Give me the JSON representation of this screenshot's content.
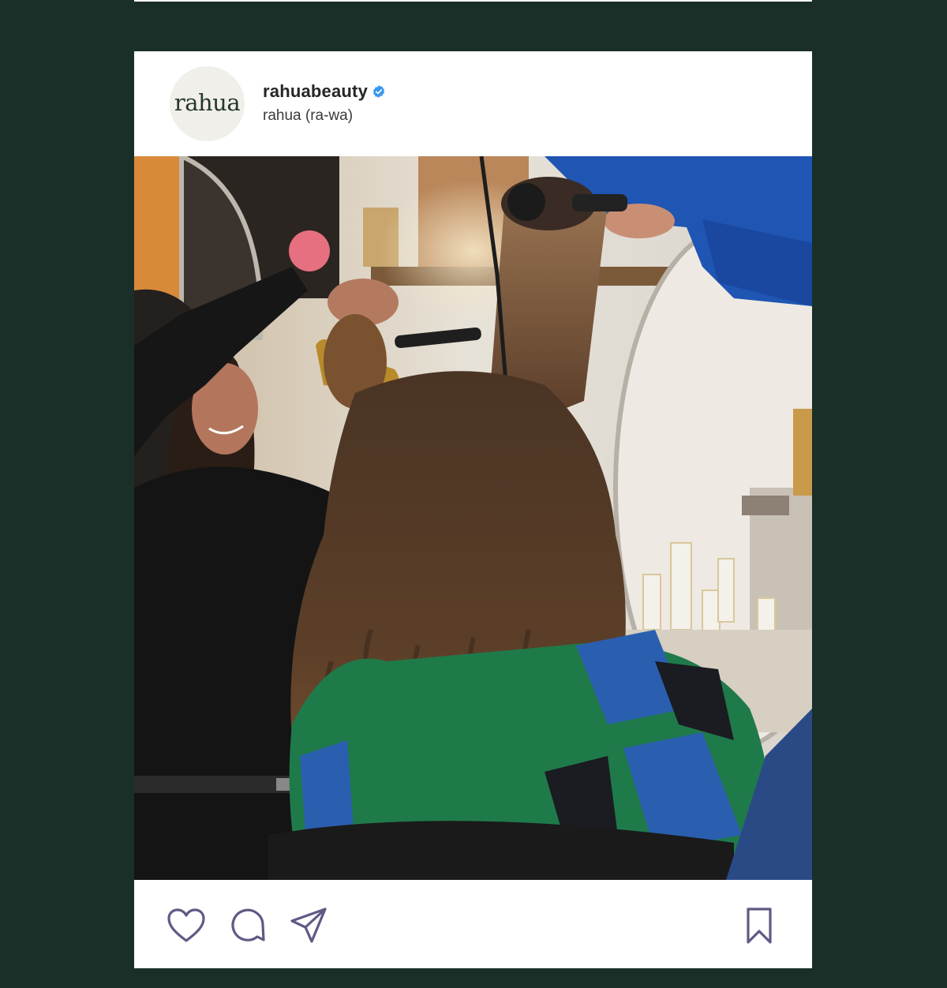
{
  "post": {
    "avatar_wordmark": "rahua",
    "username": "rahuabeauty",
    "subtitle": "rahua (ra-wa)",
    "verified_color": "#3897f0",
    "image_alt": "Stylist curling a client's long brown hair in a salon while another stylist blow-dries with a round brush",
    "actions": {
      "like_icon": "heart-icon",
      "comment_icon": "comment-icon",
      "share_icon": "share-icon",
      "save_icon": "bookmark-icon"
    }
  },
  "colors": {
    "background": "#1a2f28",
    "card": "#ffffff",
    "icon_stroke": "#5f5a84",
    "avatar_bg": "#f1efe9",
    "avatar_text": "#22382f"
  }
}
